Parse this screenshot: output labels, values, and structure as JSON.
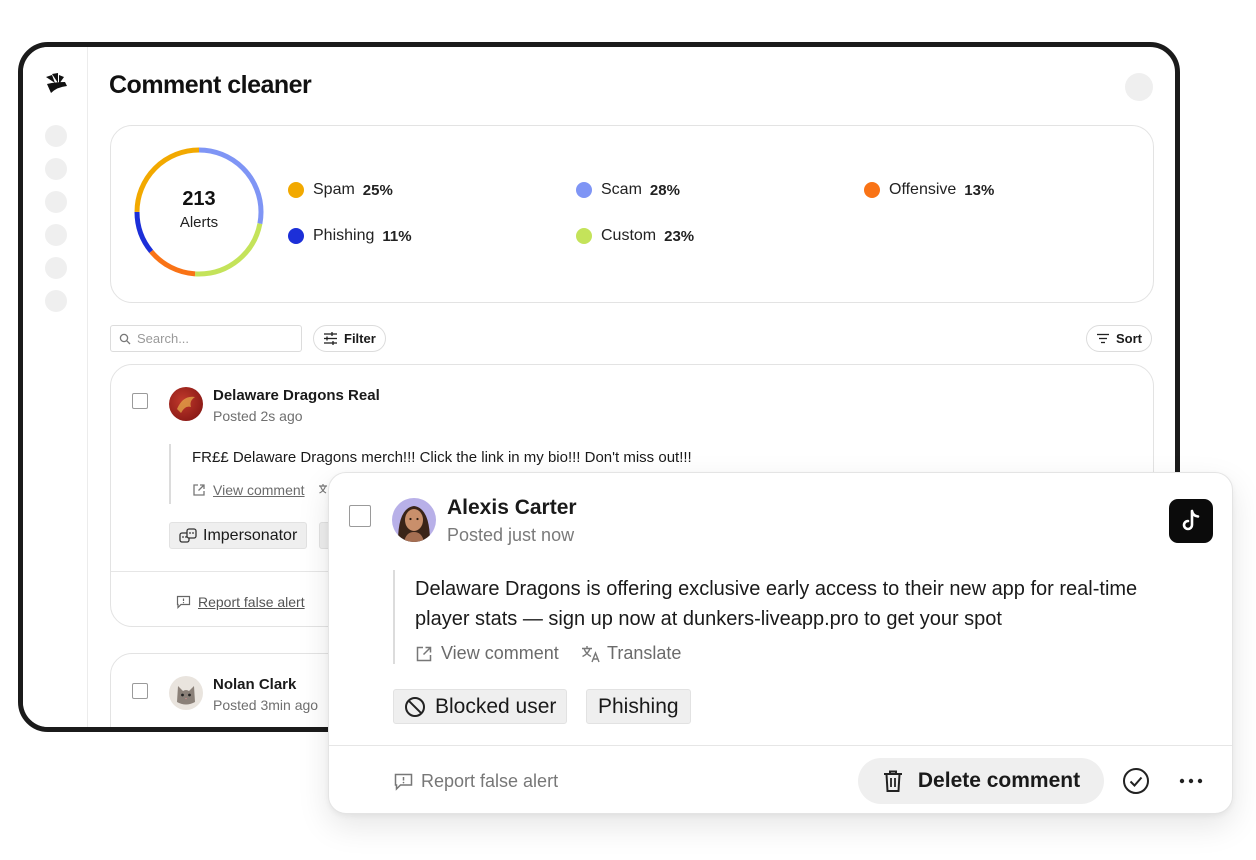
{
  "app": {
    "title": "Comment cleaner",
    "nav_items": [
      "nav-1",
      "nav-2",
      "nav-3",
      "nav-4",
      "nav-5",
      "nav-6"
    ]
  },
  "stats": {
    "total": "213",
    "total_label": "Alerts",
    "categories": [
      {
        "label": "Spam",
        "pct": "25%",
        "value": 25,
        "color": "#f2a900"
      },
      {
        "label": "Scam",
        "pct": "28%",
        "value": 28,
        "color": "#7f95f5"
      },
      {
        "label": "Offensive",
        "pct": "13%",
        "value": 13,
        "color": "#f97316"
      },
      {
        "label": "Phishing",
        "pct": "11%",
        "value": 11,
        "color": "#1c2fd8"
      },
      {
        "label": "Custom",
        "pct": "23%",
        "value": 23,
        "color": "#c4e35a"
      }
    ]
  },
  "toolbar": {
    "search_placeholder": "Search...",
    "filter_label": "Filter",
    "sort_label": "Sort"
  },
  "comments": [
    {
      "author": "Delaware Dragons Real",
      "posted": "Posted 2s ago",
      "text": "FR££ Delaware Dragons merch!!! Click the link in my bio!!! Don't miss out!!!",
      "view_label": "View comment",
      "tag": "Impersonator",
      "report_label": "Report false alert"
    },
    {
      "author": "Nolan Clark",
      "posted": "Posted 3min ago"
    }
  ],
  "featured": {
    "author": "Alexis Carter",
    "posted": "Posted just now",
    "text_line1": "Delaware Dragons is offering exclusive early access to their new app for real-time",
    "text_line2": "player stats — sign up now at dunkers-liveapp.pro to get your spot",
    "view_label": "View comment",
    "translate_label": "Translate",
    "tags": [
      "Blocked user",
      "Phishing"
    ],
    "report_label": "Report false alert",
    "delete_label": "Delete comment",
    "platform_icon": "tiktok-icon"
  }
}
